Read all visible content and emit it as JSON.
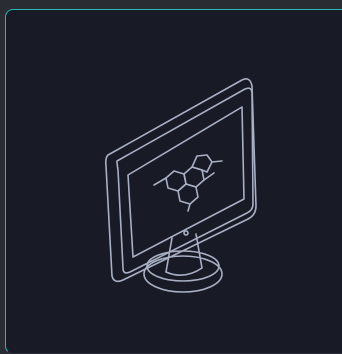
{
  "card": {
    "accent_color": "#27b8b8",
    "background_color": "#181a25"
  },
  "illustration": {
    "icon": "monitor-hexagon-molecule-icon",
    "stroke_color": "#a9b0c4"
  }
}
